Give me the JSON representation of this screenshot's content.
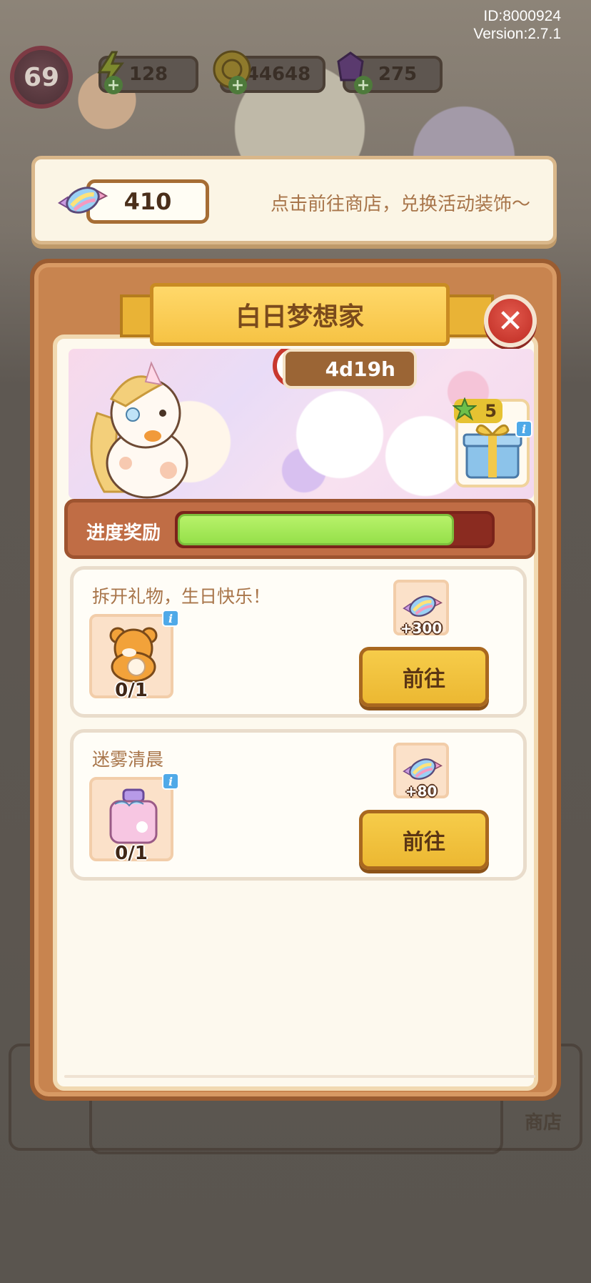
{
  "debug": {
    "id_text": "ID:8000924",
    "version_text": "Version:2.7.1"
  },
  "hud": {
    "level": "69",
    "energy": "128",
    "coins": "44648",
    "gems": "275"
  },
  "candy_banner": {
    "count": "410",
    "hint": "点击前往商店，兑换活动装饰～"
  },
  "panel": {
    "title": "白日梦想家",
    "timer": "4d19h",
    "gift_stars": "5",
    "progress_label": "进度奖励",
    "progress_fraction": 0.88
  },
  "tasks": [
    {
      "title": "拆开礼物，生日快乐！",
      "count": "0/1",
      "reward": "+300",
      "button": "前往"
    },
    {
      "title": "迷雾清晨",
      "count": "0/1",
      "reward": "+80",
      "button": "前往"
    }
  ],
  "background": {
    "shop_label": "商店"
  },
  "colors": {
    "panel_brown": "#c8844f",
    "ribbon_yellow": "#f6c344",
    "progress_green": "#95e04a",
    "close_red": "#c9392f"
  }
}
